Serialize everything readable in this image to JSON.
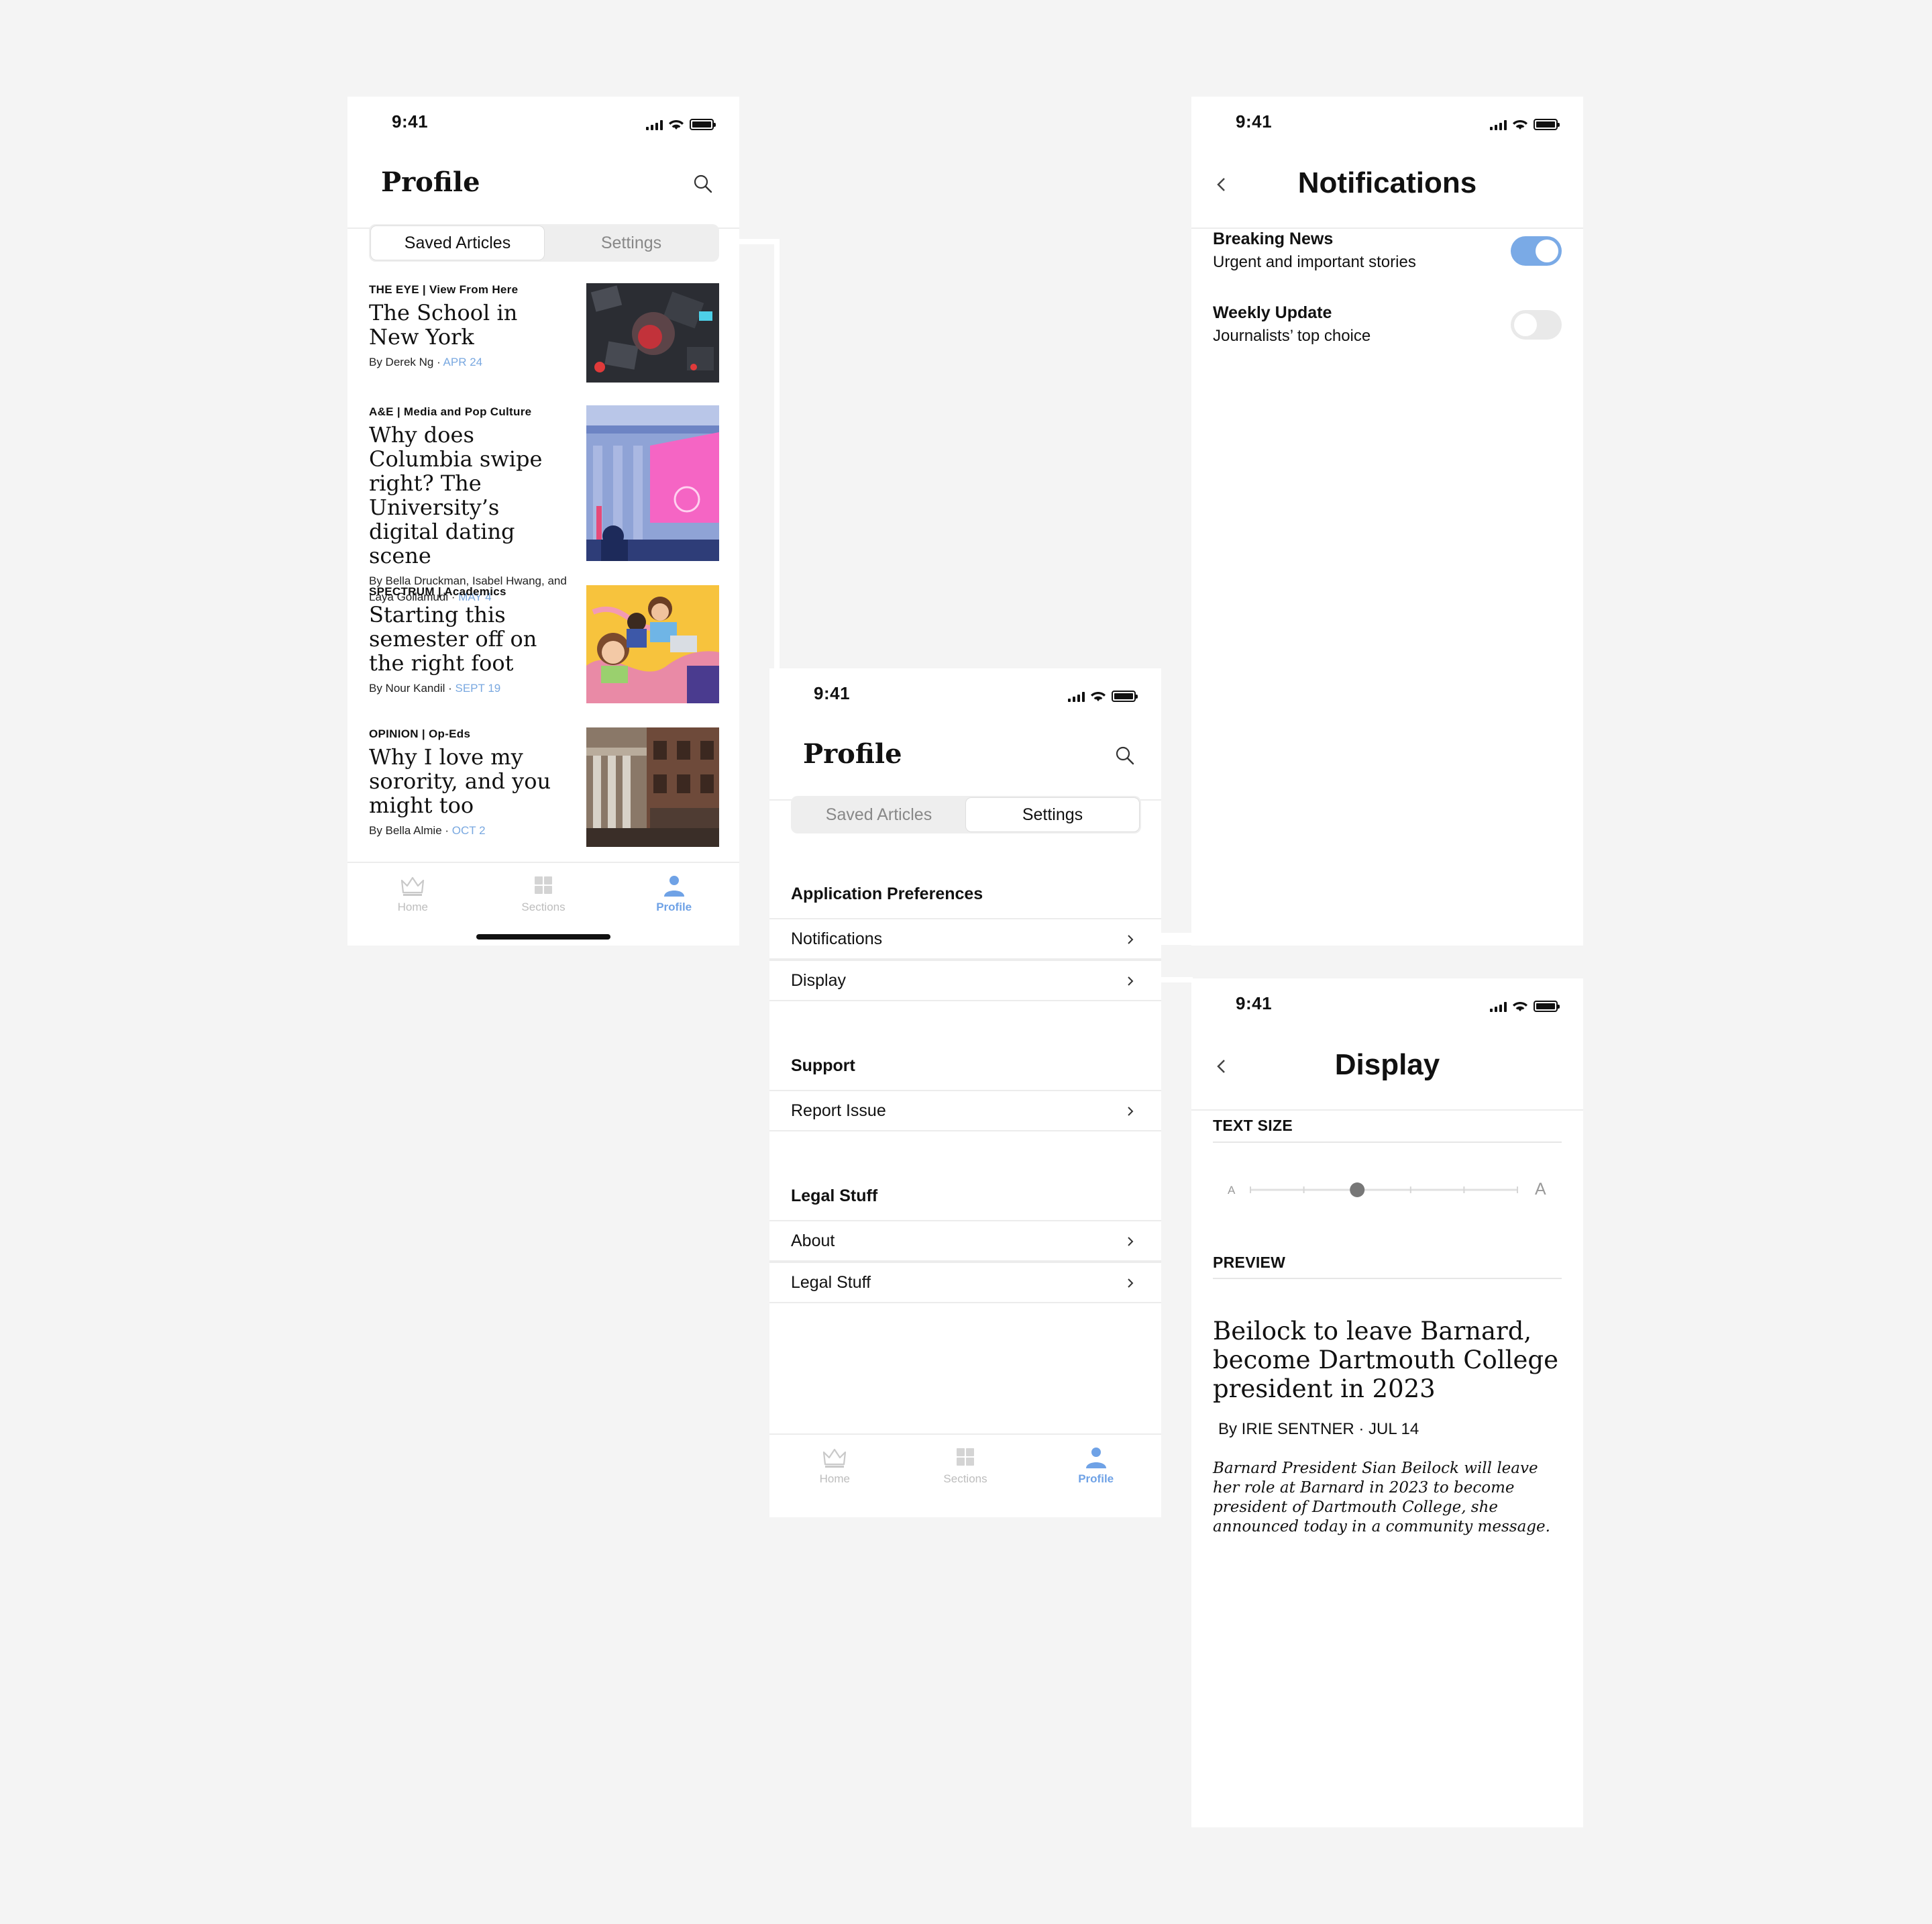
{
  "status": {
    "time": "9:41"
  },
  "colors": {
    "accent": "#6fa2e6",
    "date": "#79a8e0",
    "toggle_on": "#7aaae6",
    "toggle_off": "#e9e9e9"
  },
  "saved_screen": {
    "title": "Profile",
    "tabs": [
      "Saved Articles",
      "Settings"
    ],
    "articles": [
      {
        "kicker": "THE EYE | View From Here",
        "headline": "The School in New York",
        "byline": "By Derek Ng · ",
        "date": "APR 24"
      },
      {
        "kicker": "A&E | Media and Pop Culture",
        "headline": "Why does Columbia swipe right? The University’s digital dating scene",
        "byline": "By Bella Druckman, Isabel Hwang, and Laya Gollamudi · ",
        "date": "MAY 4"
      },
      {
        "kicker": "SPECTRUM | Academics",
        "headline": "Starting this semester off on the right foot",
        "byline": "By Nour Kandil · ",
        "date": "SEPT 19"
      },
      {
        "kicker": "OPINION | Op-Eds",
        "headline": "Why I love my sorority, and you might too",
        "byline": "By Bella Almie · ",
        "date": "OCT 2"
      }
    ]
  },
  "tabbar": {
    "home": "Home",
    "sections": "Sections",
    "profile": "Profile"
  },
  "settings_screen": {
    "title": "Profile",
    "tabs": [
      "Saved Articles",
      "Settings"
    ],
    "sections": [
      {
        "heading": "Application Preferences",
        "items": [
          "Notifications",
          "Display"
        ]
      },
      {
        "heading": "Support",
        "items": [
          "Report Issue"
        ]
      },
      {
        "heading": "Legal Stuff",
        "items": [
          "About",
          "Legal Stuff"
        ]
      }
    ]
  },
  "notifications_screen": {
    "title": "Notifications",
    "items": [
      {
        "title": "Breaking News",
        "subtitle": "Urgent and important stories",
        "enabled": true
      },
      {
        "title": "Weekly Update",
        "subtitle": "Journalists’ top choice",
        "enabled": false
      }
    ]
  },
  "display_screen": {
    "title": "Display",
    "text_size_label": "TEXT SIZE",
    "small_a": "A",
    "large_a": "A",
    "text_size_level": 2,
    "text_size_steps": 6,
    "preview_label": "PREVIEW",
    "preview": {
      "headline": "Beilock to leave Barnard, become Dartmouth College president in 2023",
      "byline": "By IRIE SENTNER · JUL 14",
      "body": "Barnard President Sian Beilock will leave her role at Barnard in 2023 to become president of Dartmouth College, she announced today in a community message."
    }
  }
}
